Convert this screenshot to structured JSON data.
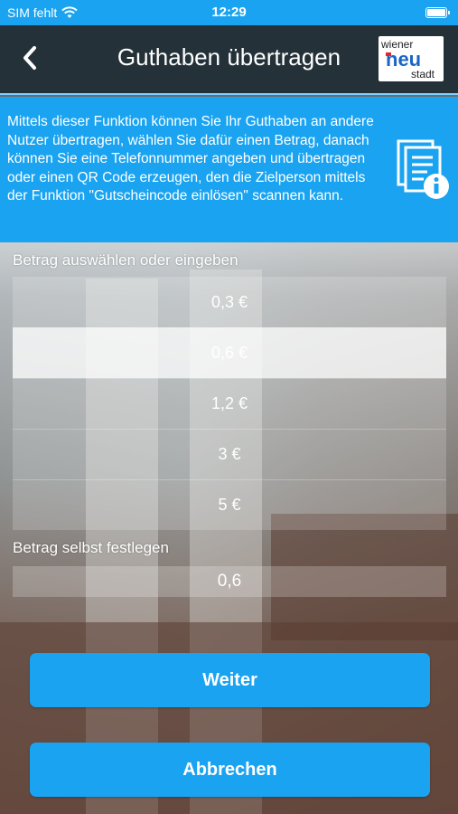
{
  "status_bar": {
    "carrier": "SIM fehlt",
    "time": "12:29",
    "wifi_icon": "wifi-icon",
    "battery_icon": "battery-icon"
  },
  "nav": {
    "title": "Guthaben übertragen",
    "back_icon": "chevron-left-icon",
    "logo": {
      "line1": "wiener",
      "line2": "neu",
      "line3": "stadt"
    }
  },
  "info": {
    "text": "Mittels dieser Funktion können Sie Ihr Guthaben an andere Nutzer übertragen, wählen Sie dafür einen Betrag, danach können Sie eine Telefonnummer angeben und übertragen oder einen QR Code erzeugen, den die Zielperson mittels der Funktion \"Gutscheincode einlösen\" scannen kann.",
    "icon": "document-info-icon"
  },
  "amount_section": {
    "label": "Betrag auswählen oder eingeben",
    "options": [
      {
        "label": "0,3  €",
        "selected": false
      },
      {
        "label": "0,6  €",
        "selected": true
      },
      {
        "label": "1,2  €",
        "selected": false
      },
      {
        "label": "3  €",
        "selected": false
      },
      {
        "label": "5  €",
        "selected": false
      }
    ]
  },
  "custom_section": {
    "label": "Betrag selbst festlegen",
    "value": "0,6"
  },
  "buttons": {
    "next": "Weiter",
    "cancel": "Abbrechen"
  },
  "colors": {
    "accent": "#1aa3f0",
    "navbar": "#253139"
  }
}
